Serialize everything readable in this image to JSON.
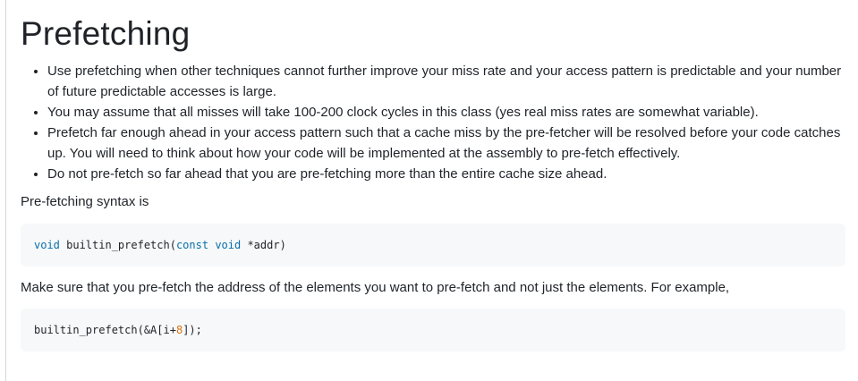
{
  "heading": "Prefetching",
  "bullets": [
    "Use prefetching when other techniques cannot further improve your miss rate and your access pattern is predictable and your number of future predictable accesses is large.",
    "You may assume that all misses will take 100-200 clock cycles in this class (yes real miss rates are somewhat variable).",
    "Prefetch far enough ahead in your access pattern such that a cache miss by the pre-fetcher will be resolved before your code catches up. You will need to think about how your code will be implemented at the assembly to pre-fetch effectively.",
    "Do not pre-fetch so far ahead that you are pre-fetching more than the entire cache size ahead."
  ],
  "syntax_intro": "Pre-fetching syntax is",
  "code1": {
    "kw_void": "void",
    "fn": " builtin_prefetch(",
    "kw_const": "const",
    "space": " ",
    "kw_void2": "void",
    "rest": " *addr)"
  },
  "paragraph2": "Make sure that you pre-fetch the address of the elements you want to pre-fetch and not just the elements. For example,",
  "code2": {
    "pre": "builtin_prefetch(&A[i+",
    "num": "8",
    "post": "]);"
  },
  "colors": {
    "keyword": "#0a6fa8",
    "number": "#d9730d",
    "code_background": "#f6f8fa"
  }
}
